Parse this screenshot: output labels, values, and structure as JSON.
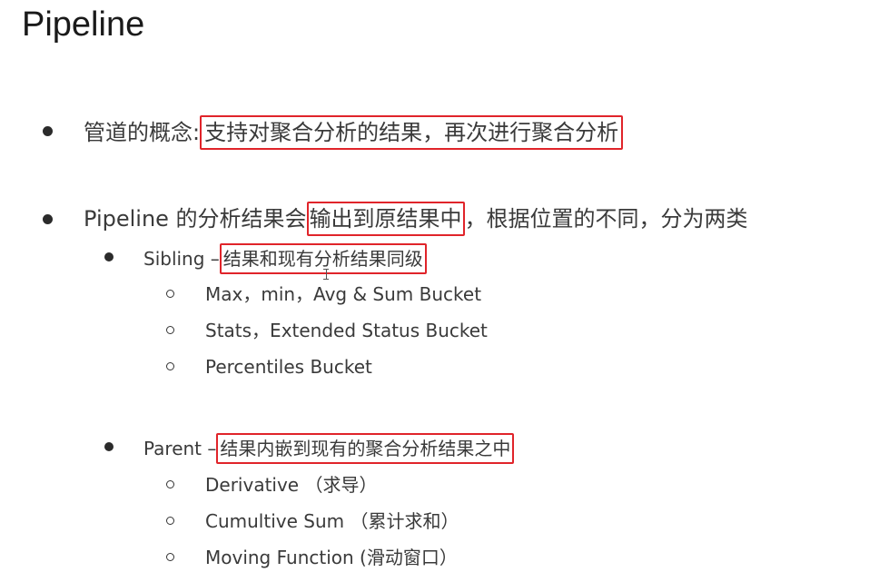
{
  "title": "Pipeline",
  "bullets": [
    {
      "prefix": "管道的概念: ",
      "highlight": "支持对聚合分析的结果，再次进行聚合分析",
      "suffix": ""
    },
    {
      "prefix": "Pipeline 的分析结果会",
      "highlight": "输出到原结果中",
      "suffix": "，根据位置的不同，分为两类"
    }
  ],
  "sibling": {
    "prefix": "Sibling – ",
    "highlight": "结果和现有分析结果同级",
    "items": [
      "Max，min，Avg & Sum Bucket",
      "Stats，Extended Status Bucket",
      "Percentiles Bucket"
    ]
  },
  "parent": {
    "prefix": "Parent – ",
    "highlight": "结果内嵌到现有的聚合分析结果之中",
    "items": [
      "Derivative （求导）",
      "Cumultive Sum （累计求和）",
      "Moving Function (滑动窗口）"
    ]
  },
  "colors": {
    "highlight_border": "#e0242a",
    "text": "#3a3a3a"
  }
}
